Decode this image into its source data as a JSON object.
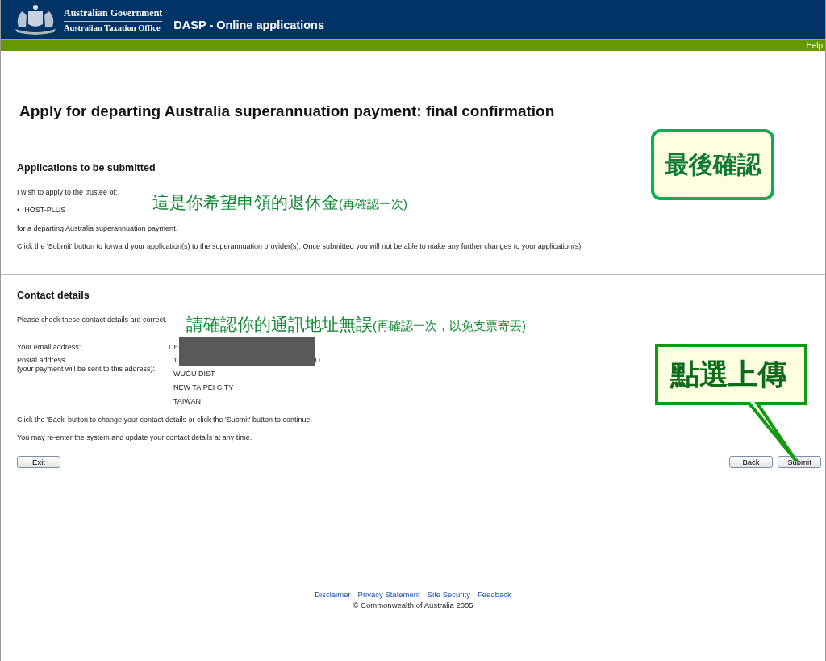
{
  "header": {
    "org_line_1": "Australian Government",
    "org_line_2": "Australian Taxation Office",
    "app_title": "DASP - Online applications"
  },
  "nav": {
    "help": "Help"
  },
  "page_title": "Apply for departing Australia superannuation payment: final confirmation",
  "applications": {
    "heading": "Applications to be submitted",
    "intro": "I wish to apply to the trustee of:",
    "bullet": "•",
    "trustees": [
      "HOST-PLUS"
    ],
    "purpose": "for a departing Australia superannuation payment.",
    "instruction": "Click the 'Submit' button to forward your application(s) to the superannuation provider(s). Once submitted you will not be able to make any further changes to your application(s)."
  },
  "contact": {
    "heading": "Contact details",
    "intro": "Please check these contact details are correct.",
    "email_label": "Your email address:",
    "email_value": "DE",
    "postal_label": "Postal address",
    "postal_note": "(your payment will be sent to this address):",
    "postal_lines": [
      {
        "parts": [
          "1",
          "D"
        ]
      },
      {
        "parts": [
          "WUGU DIST"
        ]
      },
      {
        "parts": [
          "NEW TAIPEI CITY"
        ]
      },
      {
        "parts": [
          "TAIWAN"
        ]
      }
    ],
    "redacted": true,
    "back_note": "Click the 'Back' button to change your contact details or click the 'Submit' button to continue.",
    "reenter_note": "You may re-enter the system and update your contact details at any time."
  },
  "buttons": {
    "exit": "Exit",
    "back": "Back",
    "submit": "Submit"
  },
  "footer": {
    "links": [
      "Disclaimer",
      "Privacy Statement",
      "Site Security",
      "Feedback"
    ],
    "copyright": "© Commonwealth of Australia 2005"
  },
  "annotations": [
    {
      "kind": "inline",
      "main": "這是你希望申領的退休金",
      "note": "(再確認一次)"
    },
    {
      "kind": "inline",
      "main": "請確認你的通訊地址無誤",
      "note": "(再確認一次，以免支票寄丟)"
    },
    {
      "kind": "box",
      "main": "最後確認"
    },
    {
      "kind": "callout",
      "main": "點選上傳"
    }
  ]
}
